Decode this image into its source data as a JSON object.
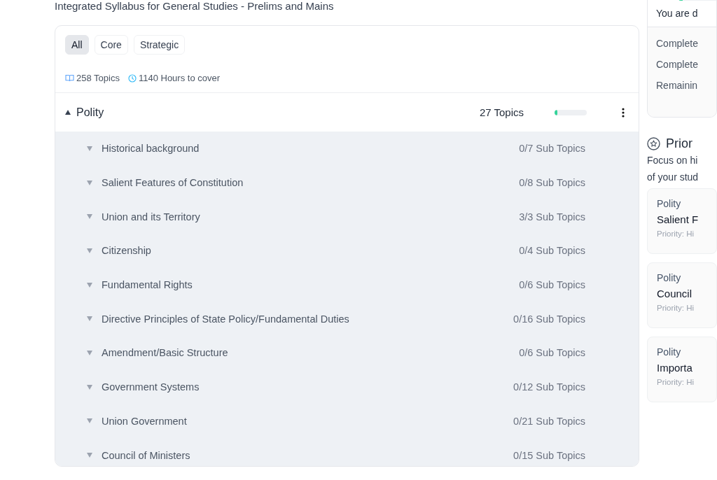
{
  "header": {
    "subtitle": "Integrated Syllabus for General Studies - Prelims and Mains"
  },
  "filters": [
    {
      "label": "All",
      "selected": true
    },
    {
      "label": "Core",
      "selected": false
    },
    {
      "label": "Strategic",
      "selected": false
    }
  ],
  "stats": {
    "topics": "258 Topics",
    "hours": "1140 Hours to cover"
  },
  "section": {
    "name": "Polity",
    "expanded": true,
    "count": "27 Topics",
    "level": 0.08,
    "subtopics": [
      {
        "name": "Historical background",
        "count": "0/7 Sub Topics",
        "expanded": false
      },
      {
        "name": "Salient Features of Constitution",
        "count": "0/8 Sub Topics",
        "expanded": false
      },
      {
        "name": "Union and its Territory",
        "count": "3/3 Sub Topics",
        "expanded": false
      },
      {
        "name": "Citizenship",
        "count": "0/4 Sub Topics",
        "expanded": false
      },
      {
        "name": "Fundamental Rights",
        "count": "0/6 Sub Topics",
        "expanded": false
      },
      {
        "name": "Directive Principles of State Policy/Fundamental Duties",
        "count": "0/16 Sub Topics",
        "expanded": false
      },
      {
        "name": "Amendment/Basic Structure",
        "count": "0/6 Sub Topics",
        "expanded": false
      },
      {
        "name": "Government Systems",
        "count": "0/12 Sub Topics",
        "expanded": false
      },
      {
        "name": "Union Government",
        "count": "0/21 Sub Topics",
        "expanded": false
      },
      {
        "name": "Council of Ministers",
        "count": "0/15 Sub Topics",
        "expanded": false
      }
    ]
  },
  "sidebar": {
    "progress": {
      "level": 0.1,
      "message": "You are d",
      "items": [
        "Complete",
        "Complete",
        "Remainin"
      ]
    },
    "priority": {
      "title": "Prior",
      "description": [
        "Focus on hi",
        "of your stud"
      ],
      "cards": [
        {
          "subject": "Polity",
          "topic": "Salient F",
          "priority": "Priority: Hi"
        },
        {
          "subject": "Polity",
          "topic": "Council",
          "priority": "Priority: Hi"
        },
        {
          "subject": "Polity",
          "topic": "Importa",
          "priority": "Priority: Hi"
        }
      ]
    }
  }
}
